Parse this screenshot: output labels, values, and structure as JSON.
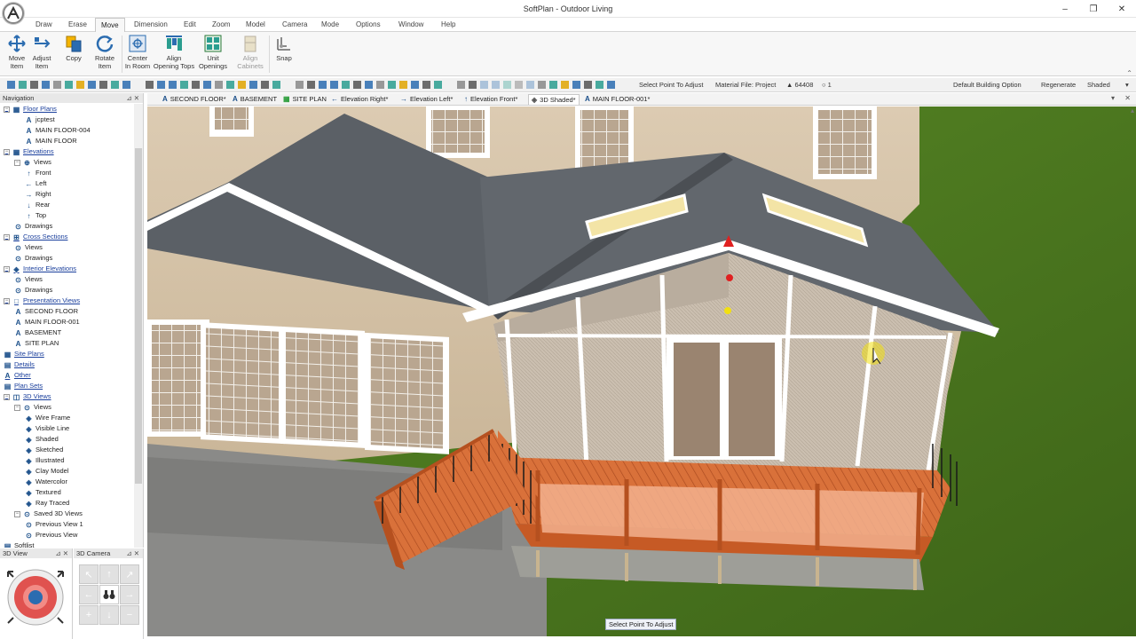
{
  "app": {
    "title": "SoftPlan - Outdoor Living"
  },
  "window_controls": {
    "minimize": "–",
    "maximize": "❐",
    "close": "✕"
  },
  "menu": [
    "Draw",
    "Erase",
    "Move",
    "Dimension",
    "Edit",
    "Zoom",
    "Model",
    "Camera",
    "Mode",
    "Options",
    "Window",
    "Help"
  ],
  "menu_active": "Move",
  "ribbon": {
    "move_item": "Move\nItem",
    "adjust_item": "Adjust\nItem",
    "copy": "Copy",
    "rotate_item": "Rotate\nItem",
    "center_in_room": "Center\nIn Room",
    "align_opening_tops": "Align\nOpening Tops",
    "unit_openings": "Unit\nOpenings",
    "align_cabinets": "Align\nCabinets",
    "snap": "Snap"
  },
  "toolbar": {
    "prompt": "Select Point To Adjust",
    "material_file": "Material File: Project",
    "counter": "▲ 64408",
    "circle_count": "○ 1",
    "building_option": "Default Building Option",
    "regenerate": "Regenerate",
    "render_mode": "Shaded"
  },
  "tabs": [
    "SECOND FLOOR*",
    "BASEMENT",
    "SITE PLAN",
    "Elevation Right*",
    "Elevation Left*",
    "Elevation Front*",
    "3D Shaded*",
    "MAIN FLOOR-001*"
  ],
  "tab_icons": [
    "A",
    "A",
    "▦",
    "←",
    "→",
    "↑",
    "◈",
    "A"
  ],
  "active_tab": "3D Shaded*",
  "navigation": {
    "title": "Navigation",
    "tree": [
      {
        "label": "Floor Plans",
        "cat": true
      },
      {
        "label": "jcptest"
      },
      {
        "label": "MAIN FLOOR-004"
      },
      {
        "label": "MAIN FLOOR"
      },
      {
        "label": "Elevations",
        "cat": true
      },
      {
        "label": "Views"
      },
      {
        "label": "Front"
      },
      {
        "label": "Left"
      },
      {
        "label": "Right"
      },
      {
        "label": "Rear"
      },
      {
        "label": "Top"
      },
      {
        "label": "Drawings"
      },
      {
        "label": "Cross Sections",
        "cat": true
      },
      {
        "label": "Views"
      },
      {
        "label": "Drawings"
      },
      {
        "label": "Interior Elevations",
        "cat": true
      },
      {
        "label": "Views"
      },
      {
        "label": "Drawings"
      },
      {
        "label": "Presentation Views",
        "cat": true
      },
      {
        "label": "SECOND FLOOR"
      },
      {
        "label": "MAIN FLOOR-001"
      },
      {
        "label": "BASEMENT"
      },
      {
        "label": "SITE PLAN"
      },
      {
        "label": "Site Plans",
        "cat": true
      },
      {
        "label": "Details",
        "cat": true
      },
      {
        "label": "Other",
        "cat": true
      },
      {
        "label": "Plan Sets",
        "cat": true
      },
      {
        "label": "3D Views",
        "cat": true
      },
      {
        "label": "Views"
      },
      {
        "label": "Wire Frame"
      },
      {
        "label": "Visible Line"
      },
      {
        "label": "Shaded"
      },
      {
        "label": "Sketched"
      },
      {
        "label": "Illustrated"
      },
      {
        "label": "Clay Model"
      },
      {
        "label": "Watercolor"
      },
      {
        "label": "Textured"
      },
      {
        "label": "Ray Traced"
      },
      {
        "label": "Saved 3D Views"
      },
      {
        "label": "Previous View 1"
      },
      {
        "label": "Previous View"
      },
      {
        "label": "Softlist"
      }
    ]
  },
  "panes": {
    "view3d": "3D View",
    "camera3d": "3D Camera"
  },
  "status_tooltip": "Select Point To Adjust",
  "colors": {
    "accent": "#2b6cb0",
    "active_tab": "#ffffff",
    "grass": "#3f6a1c",
    "deck": "#d9713a",
    "roof": "#5b6066",
    "siding": "#d7c6ad"
  }
}
